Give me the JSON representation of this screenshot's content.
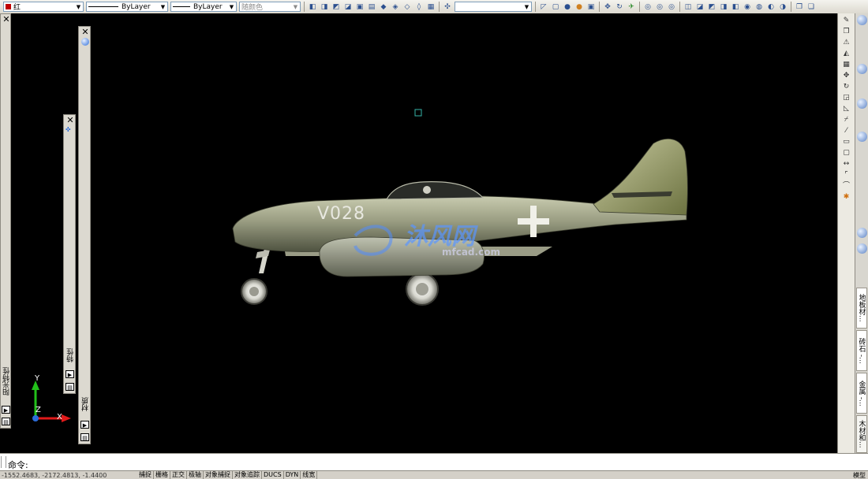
{
  "toolbar": {
    "color_value": "红",
    "linetype_value": "ByLayer",
    "lineweight_value": "ByLayer",
    "plotstyle_value": "随颜色"
  },
  "viewport": {
    "aircraft_marking": "V028",
    "watermark_text": "沐风网",
    "watermark_url": "mfcad.com",
    "ucs_y_label": "Y",
    "ucs_z_label": "Z",
    "ucs_x_label": "X"
  },
  "left_panels": {
    "sun_properties_title": "阳光特性",
    "properties_title": "特性",
    "materials_title": "材质"
  },
  "palette_tabs": [
    "地板材...",
    "砖石 -...",
    "金属 -...",
    "木材和..."
  ],
  "command_line": {
    "prompt": "命令:"
  },
  "status_bar": {
    "coords": "-1552.4683, -2172.4813, -1.4400",
    "buttons": [
      "捕捉",
      "栅格",
      "正交",
      "极轴",
      "对象捕捉",
      "对象追踪",
      "DUCS",
      "DYN",
      "线宽"
    ],
    "right_text": "模型"
  },
  "colors": {
    "viewport_background": "#000000",
    "selected_color": "#c00000",
    "ucs_y_axis": "#22c01a",
    "ucs_x_axis": "#e01a1a",
    "pickbox": "#36b4a8"
  }
}
